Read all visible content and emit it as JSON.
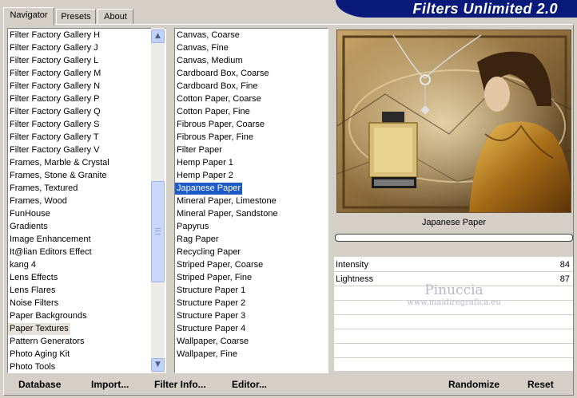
{
  "window": {
    "title": "Filters Unlimited 2.0"
  },
  "tabs": [
    {
      "label": "Navigator",
      "active": true
    },
    {
      "label": "Presets",
      "active": false
    },
    {
      "label": "About",
      "active": false
    }
  ],
  "categories": {
    "items": [
      "Filter Factory Gallery H",
      "Filter Factory Gallery J",
      "Filter Factory Gallery L",
      "Filter Factory Gallery M",
      "Filter Factory Gallery N",
      "Filter Factory Gallery P",
      "Filter Factory Gallery Q",
      "Filter Factory Gallery S",
      "Filter Factory Gallery T",
      "Filter Factory Gallery V",
      "Frames, Marble & Crystal",
      "Frames, Stone & Granite",
      "Frames, Textured",
      "Frames, Wood",
      "FunHouse",
      "Gradients",
      "Image Enhancement",
      "It@lian Editors Effect",
      "kang 4",
      "Lens Effects",
      "Lens Flares",
      "Noise Filters",
      "Paper Backgrounds",
      "Paper Textures",
      "Pattern Generators",
      "Photo Aging Kit",
      "Photo Tools"
    ],
    "selected": "Paper Textures"
  },
  "filters": {
    "items": [
      "Canvas, Coarse",
      "Canvas, Fine",
      "Canvas, Medium",
      "Cardboard Box, Coarse",
      "Cardboard Box, Fine",
      "Cotton Paper, Coarse",
      "Cotton Paper, Fine",
      "Fibrous Paper, Coarse",
      "Fibrous Paper, Fine",
      "Filter Paper",
      "Hemp Paper 1",
      "Hemp Paper 2",
      "Japanese Paper",
      "Mineral Paper, Limestone",
      "Mineral Paper, Sandstone",
      "Papyrus",
      "Rag Paper",
      "Recycling Paper",
      "Striped Paper, Coarse",
      "Striped Paper, Fine",
      "Structure Paper 1",
      "Structure Paper 2",
      "Structure Paper 3",
      "Structure Paper 4",
      "Wallpaper, Coarse",
      "Wallpaper, Fine"
    ],
    "selected": "Japanese Paper"
  },
  "preview": {
    "caption": "Japanese Paper",
    "progress": 0
  },
  "params": [
    {
      "label": "Intensity",
      "value": "84"
    },
    {
      "label": "Lightness",
      "value": "87"
    }
  ],
  "watermark": {
    "line1": "Pinuccia",
    "line2": "www.maidiregrafica.eu"
  },
  "buttons": {
    "database": "Database",
    "import": "Import...",
    "filter_info": "Filter Info...",
    "editor": "Editor...",
    "randomize": "Randomize",
    "reset": "Reset"
  },
  "colors": {
    "banner": "#0a1a7a",
    "selection": "#1c5bc6",
    "face": "#d4d0c8"
  }
}
